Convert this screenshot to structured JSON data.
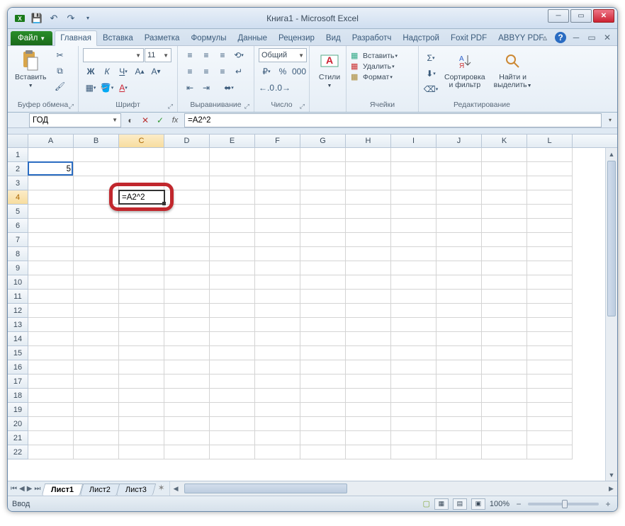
{
  "window": {
    "title": "Книга1  -  Microsoft Excel"
  },
  "qat": {
    "save": "💾",
    "undo": "↶",
    "redo": "↷",
    "more": "▾"
  },
  "tabs": {
    "file": "Файл",
    "items": [
      "Главная",
      "Вставка",
      "Разметка",
      "Формулы",
      "Данные",
      "Рецензир",
      "Вид",
      "Разработч",
      "Надстрой",
      "Foxit PDF",
      "ABBYY PDF"
    ],
    "active": 0
  },
  "ribbon": {
    "clipboard": {
      "label": "Буфер обмена",
      "paste": "Вставить"
    },
    "font": {
      "label": "Шрифт",
      "name": "",
      "size": "11"
    },
    "alignment": {
      "label": "Выравнивание"
    },
    "number": {
      "label": "Число",
      "format": "Общий"
    },
    "styles": {
      "label": "",
      "btn": "Стили"
    },
    "cells": {
      "label": "Ячейки",
      "insert": "Вставить",
      "delete": "Удалить",
      "format": "Формат"
    },
    "editing": {
      "label": "Редактирование",
      "sort": "Сортировка\nи фильтр",
      "find": "Найти и\nвыделить"
    }
  },
  "formula_bar": {
    "name_box": "ГОД",
    "formula": "=A2^2"
  },
  "grid": {
    "columns": [
      "A",
      "B",
      "C",
      "D",
      "E",
      "F",
      "G",
      "H",
      "I",
      "J",
      "K",
      "L"
    ],
    "row_count": 22,
    "active_col": "C",
    "active_row": 4,
    "ref_col": "A",
    "ref_row": 2,
    "cells": {
      "A2": "5",
      "C4": "=A2^2"
    }
  },
  "sheets": {
    "items": [
      "Лист1",
      "Лист2",
      "Лист3"
    ],
    "active": 0
  },
  "status": {
    "mode": "Ввод",
    "zoom": "100%"
  }
}
